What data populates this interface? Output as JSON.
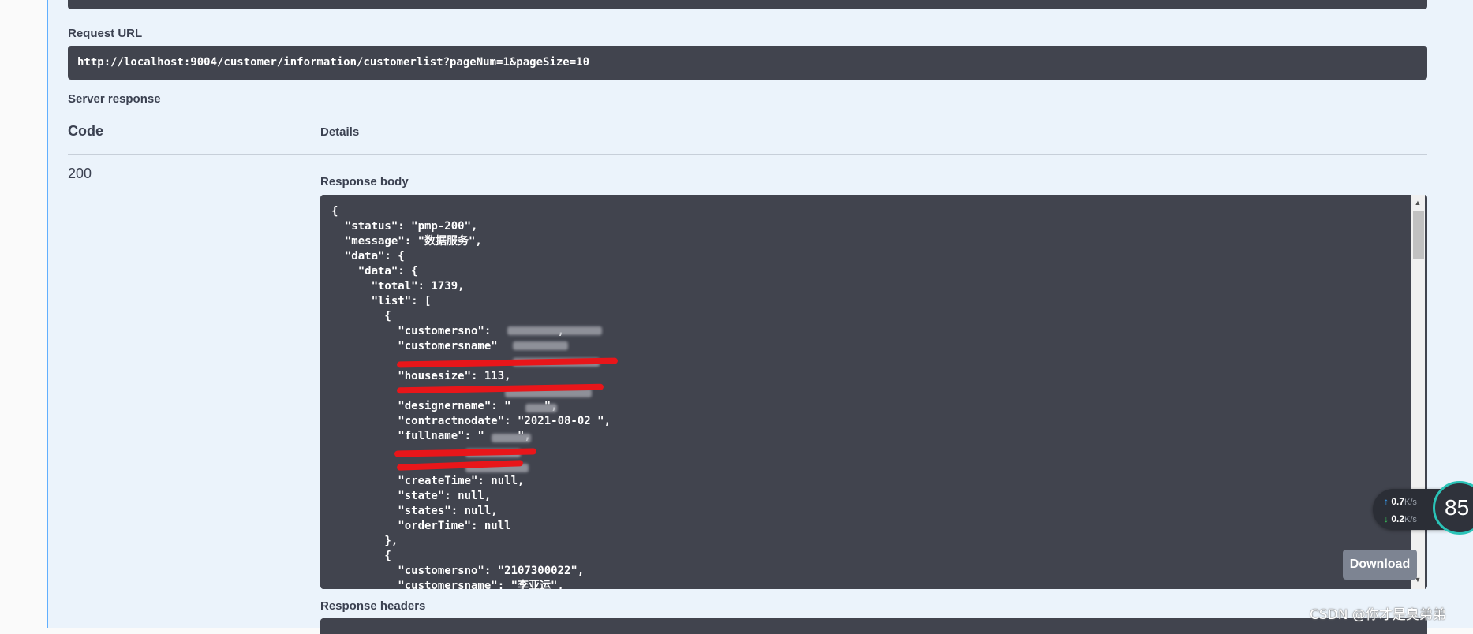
{
  "request_url_label": "Request URL",
  "request_url": "http://localhost:9004/customer/information/customerlist?pageNum=1&pageSize=10",
  "server_response_label": "Server response",
  "columns": {
    "code": "Code",
    "details": "Details"
  },
  "response": {
    "status_code": "200",
    "body_label": "Response body",
    "body_lines": [
      "{",
      "  \"status\": \"pmp-200\",",
      "  \"message\": \"数据服务\",",
      "  \"data\": {",
      "    \"data\": {",
      "      \"total\": 1739,",
      "      \"list\": [",
      "        {",
      "          \"customersno\":          ,",
      "          \"customersname\"",
      "",
      "          \"housesize\": 113,",
      "",
      "          \"designername\": \"     \",",
      "          \"contractnodate\": \"2021-08-02 \",",
      "          \"fullname\": \"     \",",
      "",
      "",
      "          \"createTime\": null,",
      "          \"state\": null,",
      "          \"states\": null,",
      "          \"orderTime\": null",
      "        },",
      "        {",
      "          \"customersno\": \"2107300022\",",
      "          \"customersname\": \"李亚运\","
    ],
    "download_label": "Download",
    "headers_label": "Response headers"
  },
  "network_widget": {
    "upload_value": "0.7",
    "upload_unit": "K/s",
    "download_value": "0.2",
    "download_unit": "K/s",
    "percent": "85"
  },
  "watermark": "CSDN @你才是臭弟弟"
}
